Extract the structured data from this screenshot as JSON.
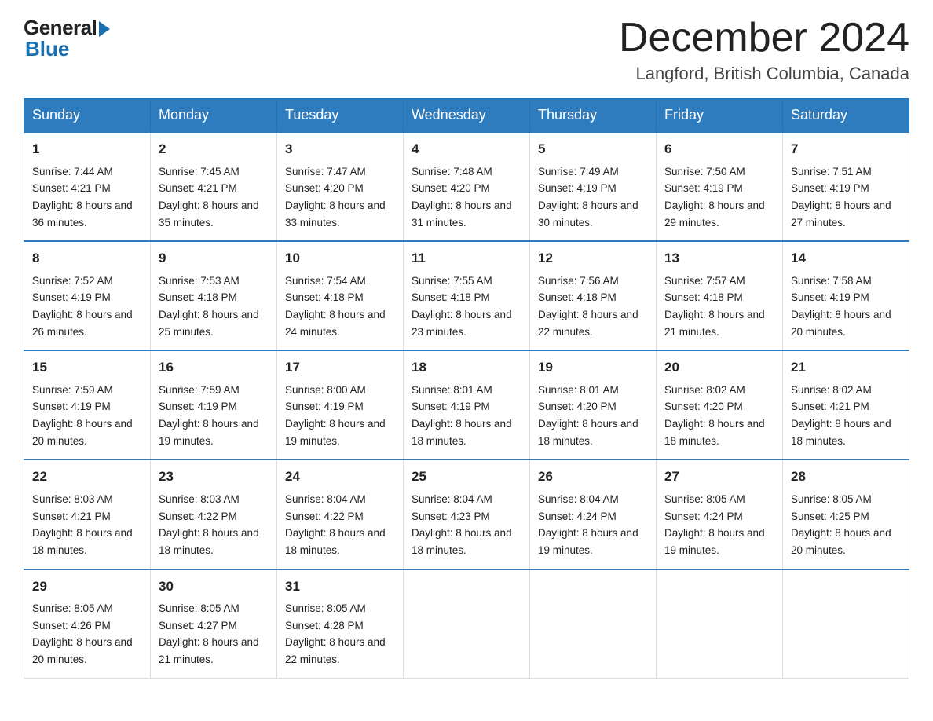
{
  "logo": {
    "general": "General",
    "blue": "Blue"
  },
  "title": "December 2024",
  "location": "Langford, British Columbia, Canada",
  "headers": [
    "Sunday",
    "Monday",
    "Tuesday",
    "Wednesday",
    "Thursday",
    "Friday",
    "Saturday"
  ],
  "weeks": [
    [
      {
        "day": "1",
        "sunrise": "7:44 AM",
        "sunset": "4:21 PM",
        "daylight": "8 hours and 36 minutes."
      },
      {
        "day": "2",
        "sunrise": "7:45 AM",
        "sunset": "4:21 PM",
        "daylight": "8 hours and 35 minutes."
      },
      {
        "day": "3",
        "sunrise": "7:47 AM",
        "sunset": "4:20 PM",
        "daylight": "8 hours and 33 minutes."
      },
      {
        "day": "4",
        "sunrise": "7:48 AM",
        "sunset": "4:20 PM",
        "daylight": "8 hours and 31 minutes."
      },
      {
        "day": "5",
        "sunrise": "7:49 AM",
        "sunset": "4:19 PM",
        "daylight": "8 hours and 30 minutes."
      },
      {
        "day": "6",
        "sunrise": "7:50 AM",
        "sunset": "4:19 PM",
        "daylight": "8 hours and 29 minutes."
      },
      {
        "day": "7",
        "sunrise": "7:51 AM",
        "sunset": "4:19 PM",
        "daylight": "8 hours and 27 minutes."
      }
    ],
    [
      {
        "day": "8",
        "sunrise": "7:52 AM",
        "sunset": "4:19 PM",
        "daylight": "8 hours and 26 minutes."
      },
      {
        "day": "9",
        "sunrise": "7:53 AM",
        "sunset": "4:18 PM",
        "daylight": "8 hours and 25 minutes."
      },
      {
        "day": "10",
        "sunrise": "7:54 AM",
        "sunset": "4:18 PM",
        "daylight": "8 hours and 24 minutes."
      },
      {
        "day": "11",
        "sunrise": "7:55 AM",
        "sunset": "4:18 PM",
        "daylight": "8 hours and 23 minutes."
      },
      {
        "day": "12",
        "sunrise": "7:56 AM",
        "sunset": "4:18 PM",
        "daylight": "8 hours and 22 minutes."
      },
      {
        "day": "13",
        "sunrise": "7:57 AM",
        "sunset": "4:18 PM",
        "daylight": "8 hours and 21 minutes."
      },
      {
        "day": "14",
        "sunrise": "7:58 AM",
        "sunset": "4:19 PM",
        "daylight": "8 hours and 20 minutes."
      }
    ],
    [
      {
        "day": "15",
        "sunrise": "7:59 AM",
        "sunset": "4:19 PM",
        "daylight": "8 hours and 20 minutes."
      },
      {
        "day": "16",
        "sunrise": "7:59 AM",
        "sunset": "4:19 PM",
        "daylight": "8 hours and 19 minutes."
      },
      {
        "day": "17",
        "sunrise": "8:00 AM",
        "sunset": "4:19 PM",
        "daylight": "8 hours and 19 minutes."
      },
      {
        "day": "18",
        "sunrise": "8:01 AM",
        "sunset": "4:19 PM",
        "daylight": "8 hours and 18 minutes."
      },
      {
        "day": "19",
        "sunrise": "8:01 AM",
        "sunset": "4:20 PM",
        "daylight": "8 hours and 18 minutes."
      },
      {
        "day": "20",
        "sunrise": "8:02 AM",
        "sunset": "4:20 PM",
        "daylight": "8 hours and 18 minutes."
      },
      {
        "day": "21",
        "sunrise": "8:02 AM",
        "sunset": "4:21 PM",
        "daylight": "8 hours and 18 minutes."
      }
    ],
    [
      {
        "day": "22",
        "sunrise": "8:03 AM",
        "sunset": "4:21 PM",
        "daylight": "8 hours and 18 minutes."
      },
      {
        "day": "23",
        "sunrise": "8:03 AM",
        "sunset": "4:22 PM",
        "daylight": "8 hours and 18 minutes."
      },
      {
        "day": "24",
        "sunrise": "8:04 AM",
        "sunset": "4:22 PM",
        "daylight": "8 hours and 18 minutes."
      },
      {
        "day": "25",
        "sunrise": "8:04 AM",
        "sunset": "4:23 PM",
        "daylight": "8 hours and 18 minutes."
      },
      {
        "day": "26",
        "sunrise": "8:04 AM",
        "sunset": "4:24 PM",
        "daylight": "8 hours and 19 minutes."
      },
      {
        "day": "27",
        "sunrise": "8:05 AM",
        "sunset": "4:24 PM",
        "daylight": "8 hours and 19 minutes."
      },
      {
        "day": "28",
        "sunrise": "8:05 AM",
        "sunset": "4:25 PM",
        "daylight": "8 hours and 20 minutes."
      }
    ],
    [
      {
        "day": "29",
        "sunrise": "8:05 AM",
        "sunset": "4:26 PM",
        "daylight": "8 hours and 20 minutes."
      },
      {
        "day": "30",
        "sunrise": "8:05 AM",
        "sunset": "4:27 PM",
        "daylight": "8 hours and 21 minutes."
      },
      {
        "day": "31",
        "sunrise": "8:05 AM",
        "sunset": "4:28 PM",
        "daylight": "8 hours and 22 minutes."
      },
      null,
      null,
      null,
      null
    ]
  ]
}
